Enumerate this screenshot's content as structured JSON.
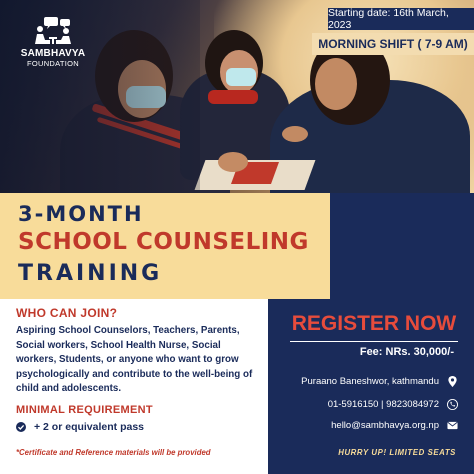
{
  "logo": {
    "name": "SAMBHAVYA",
    "subtitle": "FOUNDATION"
  },
  "header": {
    "starting_date": "Starting date: 16th March, 2023",
    "shift": "MORNING SHIFT ( 7-9 AM)"
  },
  "title": {
    "line1": "3-MONTH",
    "line2": "SCHOOL COUNSELING",
    "line3": "TRAINING"
  },
  "who_can_join": {
    "heading": "WHO CAN JOIN?",
    "text": "Aspiring School Counselors, Teachers, Parents, Social workers, School Health Nurse, Social workers, Students, or anyone who want to grow psychologically and contribute to the well-being of child and adolescents."
  },
  "requirement": {
    "heading": "MINIMAL REQUIREMENT",
    "items": [
      "+ 2 or equivalent pass"
    ],
    "icon": "check-circle-icon"
  },
  "note": "*Certificate and Reference materials will be provided",
  "register": {
    "label": "REGISTER NOW",
    "fee": "Fee: NRs. 30,000/-",
    "address": "Puraano Baneshwor, kathmandu",
    "phone": "01-5916150 | 9823084972",
    "email": "hello@sambhavya.org.np",
    "hurry": "HURRY UP! LIMITED SEATS",
    "icons": [
      "location-pin-icon",
      "phone-icon",
      "email-icon"
    ]
  },
  "colors": {
    "navy": "#1a2b5a",
    "red": "#c0392b",
    "cream": "#f8dc9a",
    "register_red": "#e74c3c"
  }
}
